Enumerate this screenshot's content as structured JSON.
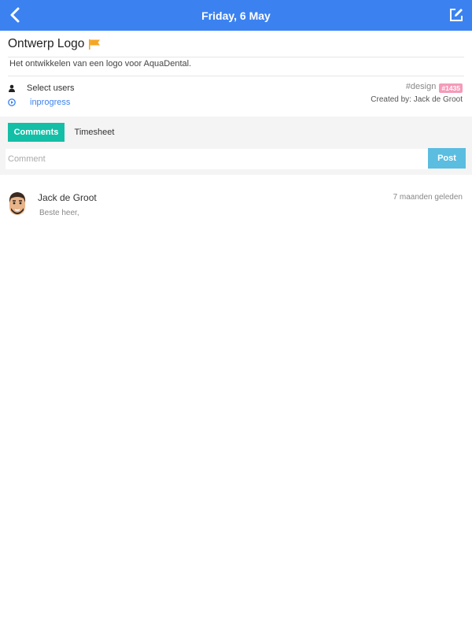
{
  "header": {
    "title": "Friday, 6 May"
  },
  "task": {
    "title": "Ontwerp Logo",
    "description": "Het ontwikkelen van een logo voor AquaDental.",
    "select_users": "Select users",
    "status": "inprogress",
    "tag": "#design",
    "id": "#1435",
    "created_by": "Created by: Jack de Groot"
  },
  "tabs": {
    "comments": "Comments",
    "timesheet": "Timesheet"
  },
  "comment_form": {
    "placeholder": "Comment",
    "post_label": "Post"
  },
  "comments": [
    {
      "author": "Jack de Groot",
      "time": "7 maanden geleden",
      "text": "Beste heer,"
    }
  ],
  "colors": {
    "header": "#3b82f0",
    "tab_active": "#13bfa6",
    "post_button": "#5bbde0",
    "badge": "#f49bb8",
    "flag": "#f5a623"
  }
}
